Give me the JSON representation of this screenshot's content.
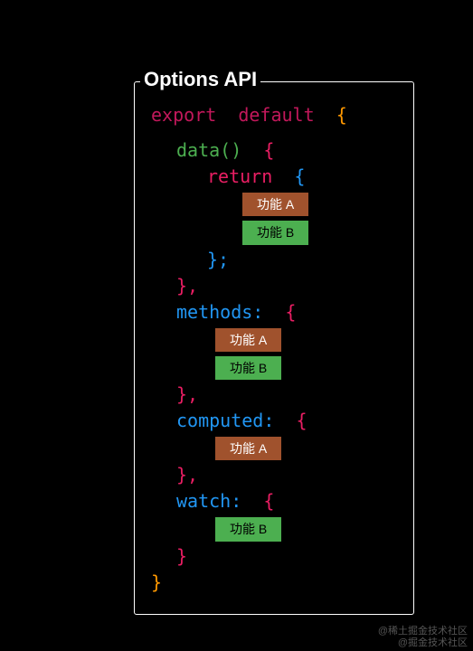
{
  "frame": {
    "title": "Options API"
  },
  "code": {
    "export": "export",
    "default": "default",
    "brace_open": "{",
    "brace_close": "}",
    "data": "data",
    "parens": "()",
    "return": "return",
    "semicolon": ";",
    "comma": ",",
    "methods": "methods:",
    "computed": "computed:",
    "watch": "watch:"
  },
  "badges": {
    "a": "功能 A",
    "b": "功能 B"
  },
  "watermark": {
    "line1": "@稀土掘金技术社区",
    "line2": "@掘金技术社区"
  }
}
